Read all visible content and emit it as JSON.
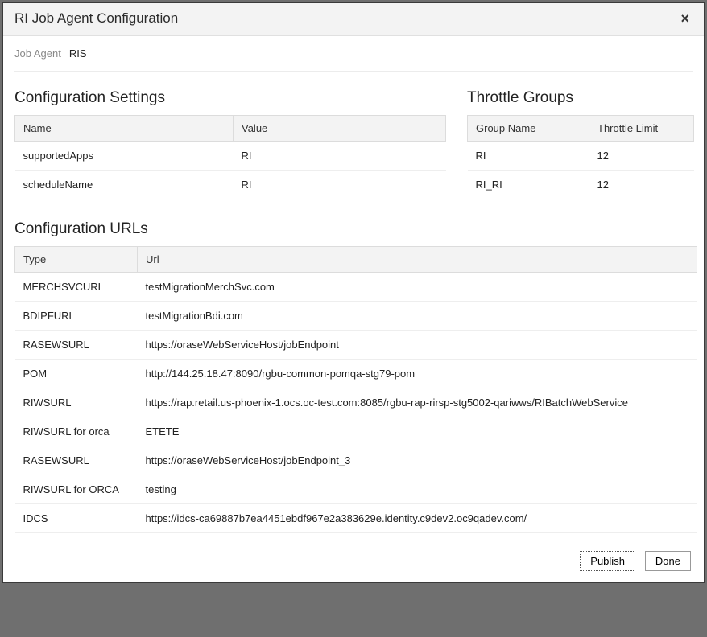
{
  "titlebar": {
    "title": "RI Job Agent Configuration",
    "close_char": "×"
  },
  "job_agent": {
    "label": "Job Agent",
    "value": "RIS"
  },
  "settings_panel": {
    "title": "Configuration Settings",
    "columns": {
      "name": "Name",
      "value": "Value"
    },
    "rows": [
      {
        "name": "supportedApps",
        "value": "RI"
      },
      {
        "name": "scheduleName",
        "value": "RI"
      }
    ]
  },
  "throttle_panel": {
    "title": "Throttle Groups",
    "columns": {
      "group": "Group Name",
      "limit": "Throttle Limit"
    },
    "rows": [
      {
        "group": "RI",
        "limit": "12"
      },
      {
        "group": "RI_RI",
        "limit": "12"
      }
    ]
  },
  "urls_panel": {
    "title": "Configuration URLs",
    "columns": {
      "type": "Type",
      "url": "Url"
    },
    "rows": [
      {
        "type": "MERCHSVCURL",
        "url": "testMigrationMerchSvc.com"
      },
      {
        "type": "BDIPFURL",
        "url": "testMigrationBdi.com"
      },
      {
        "type": "RASEWSURL",
        "url": "https://oraseWebServiceHost/jobEndpoint"
      },
      {
        "type": "POM",
        "url": "http://144.25.18.47:8090/rgbu-common-pomqa-stg79-pom"
      },
      {
        "type": "RIWSURL",
        "url": "https://rap.retail.us-phoenix-1.ocs.oc-test.com:8085/rgbu-rap-rirsp-stg5002-qariwws/RIBatchWebService"
      },
      {
        "type": "RIWSURL for orca",
        "url": "ETETE"
      },
      {
        "type": "RASEWSURL",
        "url": "https://oraseWebServiceHost/jobEndpoint_3"
      },
      {
        "type": "RIWSURL for ORCA",
        "url": "testing"
      },
      {
        "type": "IDCS",
        "url": "https://idcs-ca69887b7ea4451ebdf967e2a383629e.identity.c9dev2.oc9qadev.com/"
      }
    ]
  },
  "footer": {
    "publish_label": "Publish",
    "done_label": "Done"
  }
}
